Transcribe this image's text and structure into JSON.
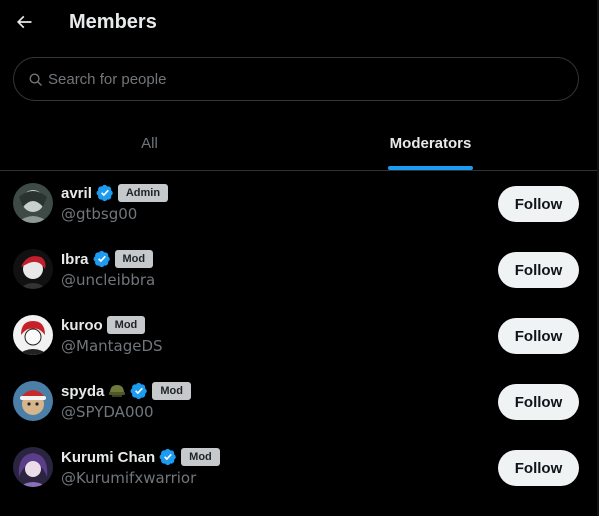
{
  "header": {
    "title": "Members",
    "back_icon": "arrow-left-icon"
  },
  "search": {
    "placeholder": "Search for people",
    "value": "",
    "icon": "search-icon"
  },
  "tabs": [
    {
      "label": "All",
      "selected": false
    },
    {
      "label": "Moderators",
      "selected": true
    }
  ],
  "colors": {
    "accent": "#1d9bf0",
    "badge_bg": "#c6c9cc",
    "muted": "#71767b",
    "follow_bg": "#eff3f4"
  },
  "members": [
    {
      "name": "avril",
      "verified": true,
      "emoji": "",
      "badge": "Admin",
      "handle": "@gtbsg00",
      "action": "Follow"
    },
    {
      "name": "Ibra",
      "verified": true,
      "emoji": "",
      "badge": "Mod",
      "handle": "@uncleibbra",
      "action": "Follow"
    },
    {
      "name": "kuroo",
      "verified": false,
      "emoji": "",
      "badge": "Mod",
      "handle": "@MantageDS",
      "action": "Follow"
    },
    {
      "name": "spyda",
      "verified": true,
      "emoji": "helmet-emoji",
      "badge": "Mod",
      "handle": "@SPYDA000",
      "action": "Follow"
    },
    {
      "name": "Kurumi Chan",
      "verified": true,
      "emoji": "",
      "badge": "Mod",
      "handle": "@Kurumifxwarrior",
      "action": "Follow"
    }
  ]
}
